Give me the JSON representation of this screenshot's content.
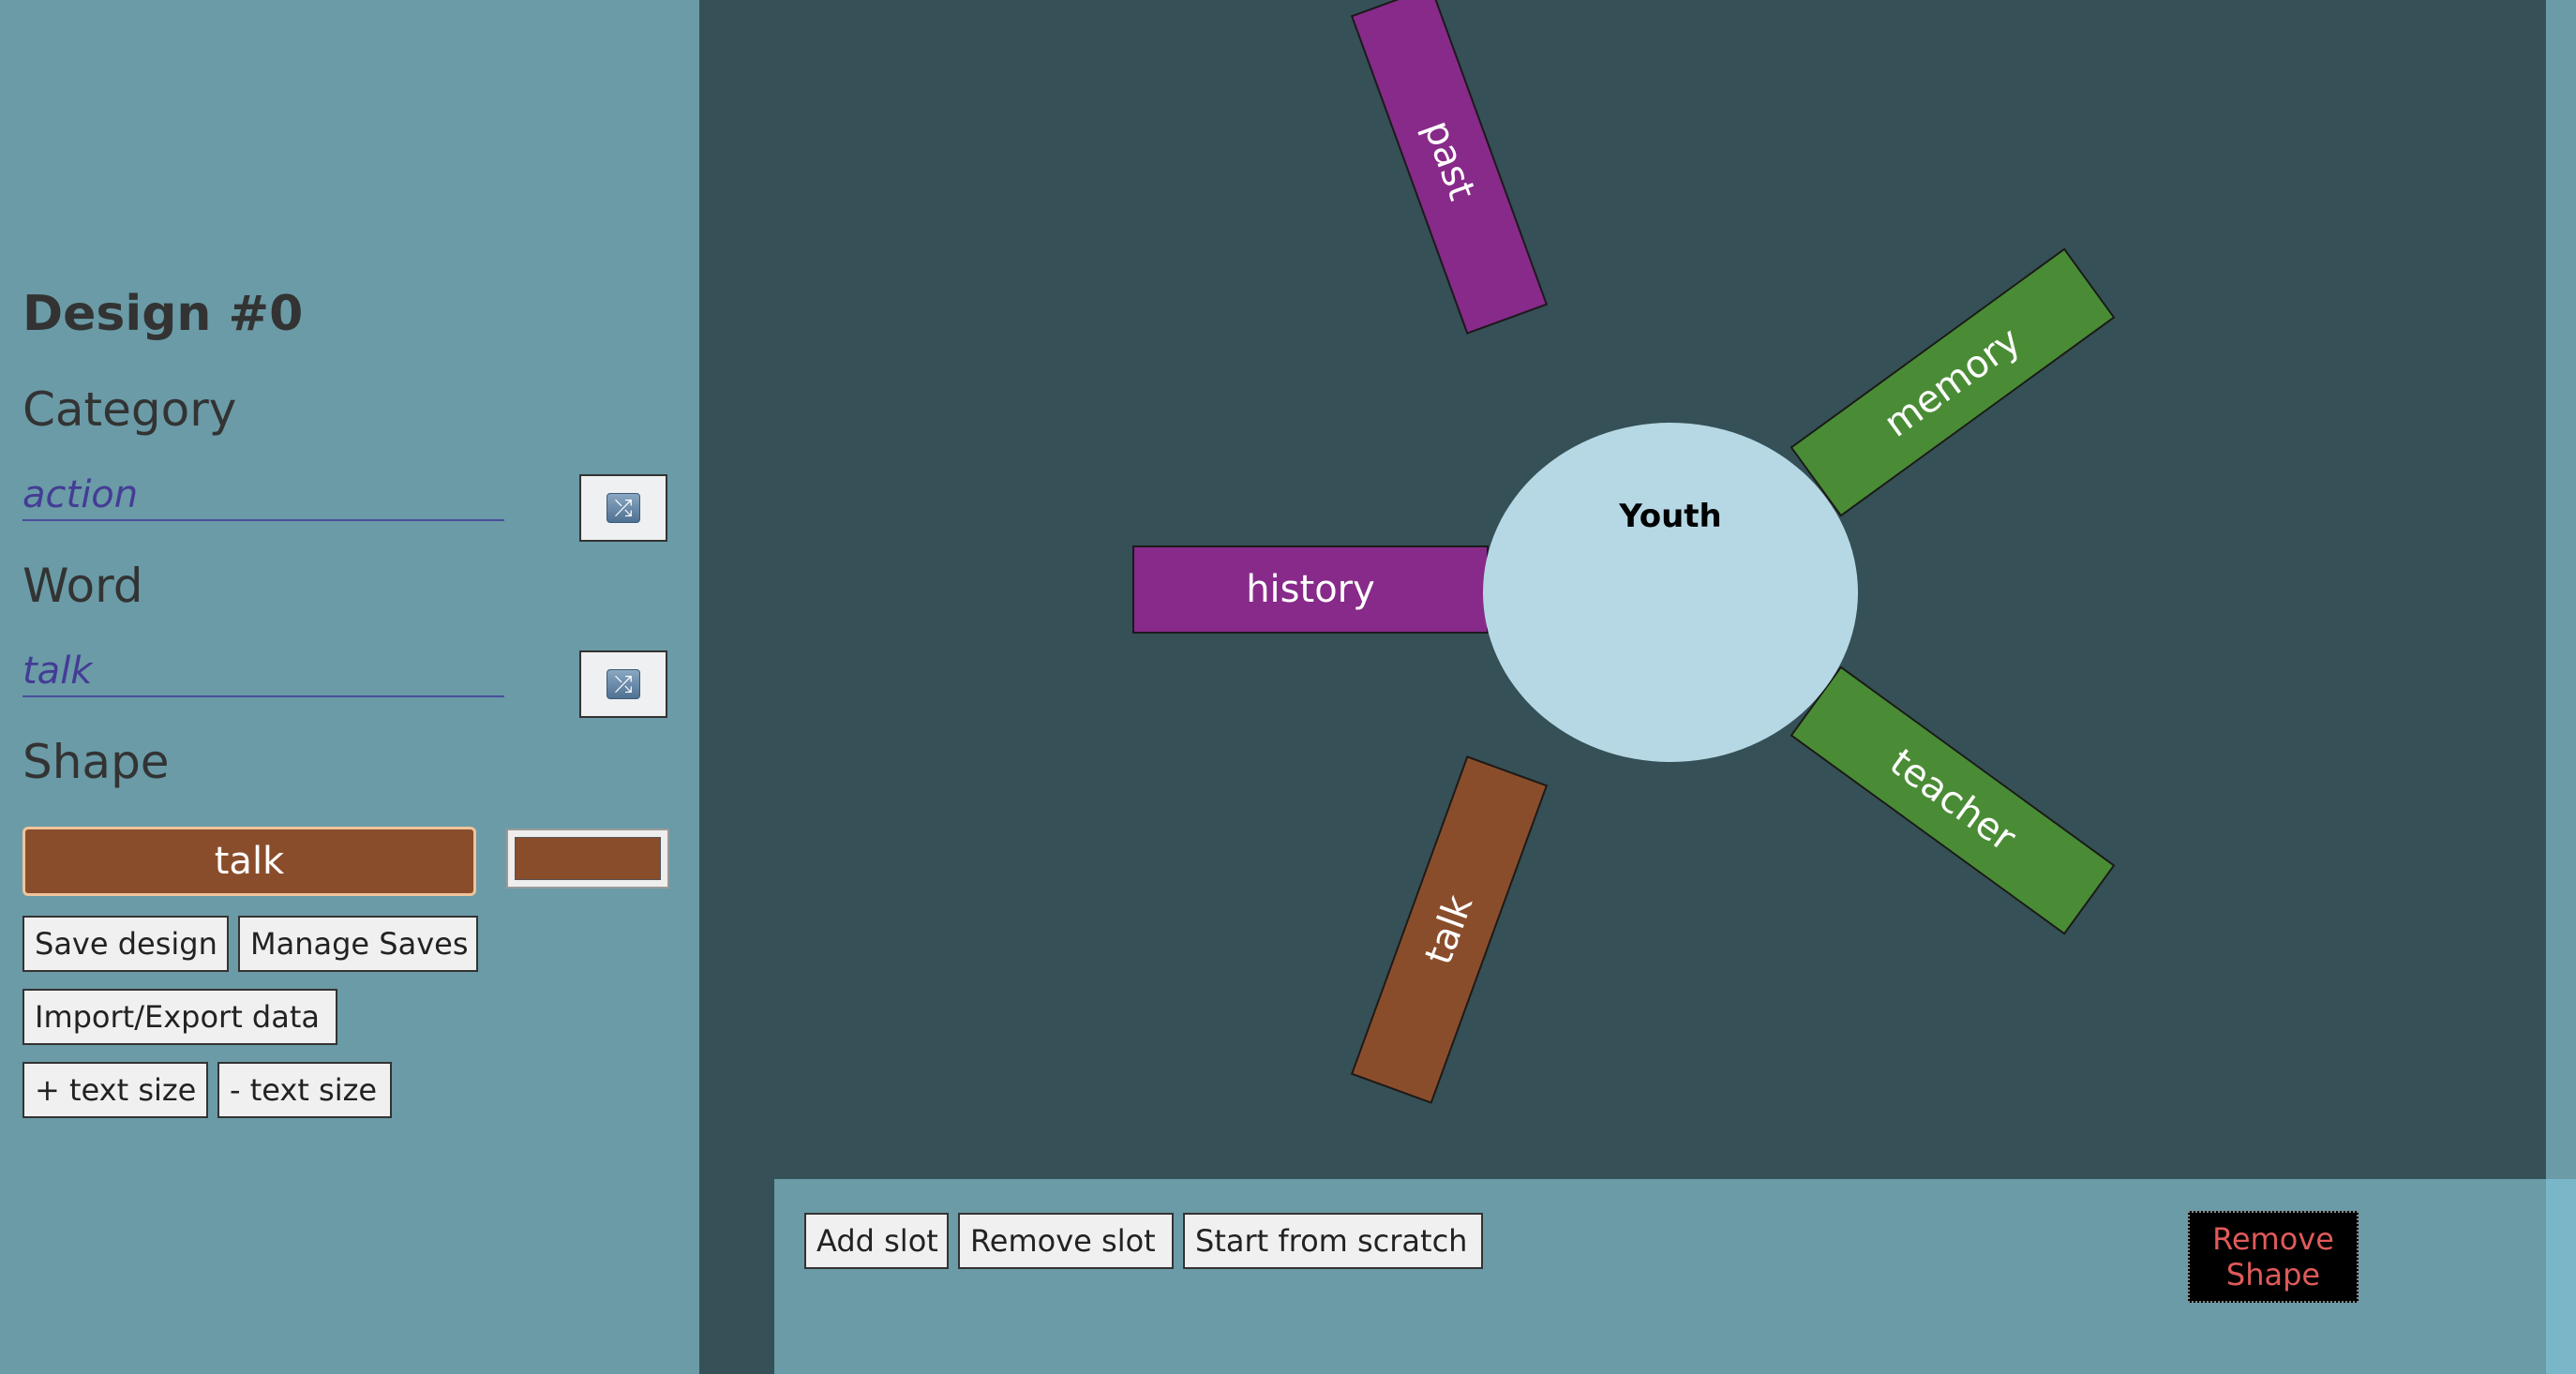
{
  "sidebar": {
    "design_title": "Design #0",
    "category_heading": "Category",
    "category_value": "action",
    "word_heading": "Word",
    "word_value": "talk",
    "shape_heading": "Shape",
    "shape_preview_label": "talk",
    "shape_color": "#8a4d2b",
    "shuffle_icon": "shuffle-icon",
    "buttons": {
      "save_design": "Save design",
      "manage_saves": "Manage Saves",
      "import_export": "Import/Export data",
      "text_size_up": "+ text size",
      "text_size_down": "- text size"
    }
  },
  "canvas": {
    "hub_label": "Youth",
    "hub_color": "#b5d8e4",
    "slots": [
      {
        "label": "past",
        "color": "#882a8a"
      },
      {
        "label": "memory",
        "color": "#4a8c35"
      },
      {
        "label": "history",
        "color": "#882a8a"
      },
      {
        "label": "teacher",
        "color": "#4a8c35"
      },
      {
        "label": "talk",
        "color": "#8a4d2b"
      }
    ]
  },
  "bottom_bar": {
    "add_slot": "Add slot",
    "remove_slot": "Remove slot",
    "start_from_scratch": "Start from scratch",
    "remove_shape": "Remove Shape"
  },
  "colors": {
    "sidebar_bg": "#6a9ba7",
    "canvas_bg": "#355056",
    "remove_shape_text": "#e05a5a"
  }
}
